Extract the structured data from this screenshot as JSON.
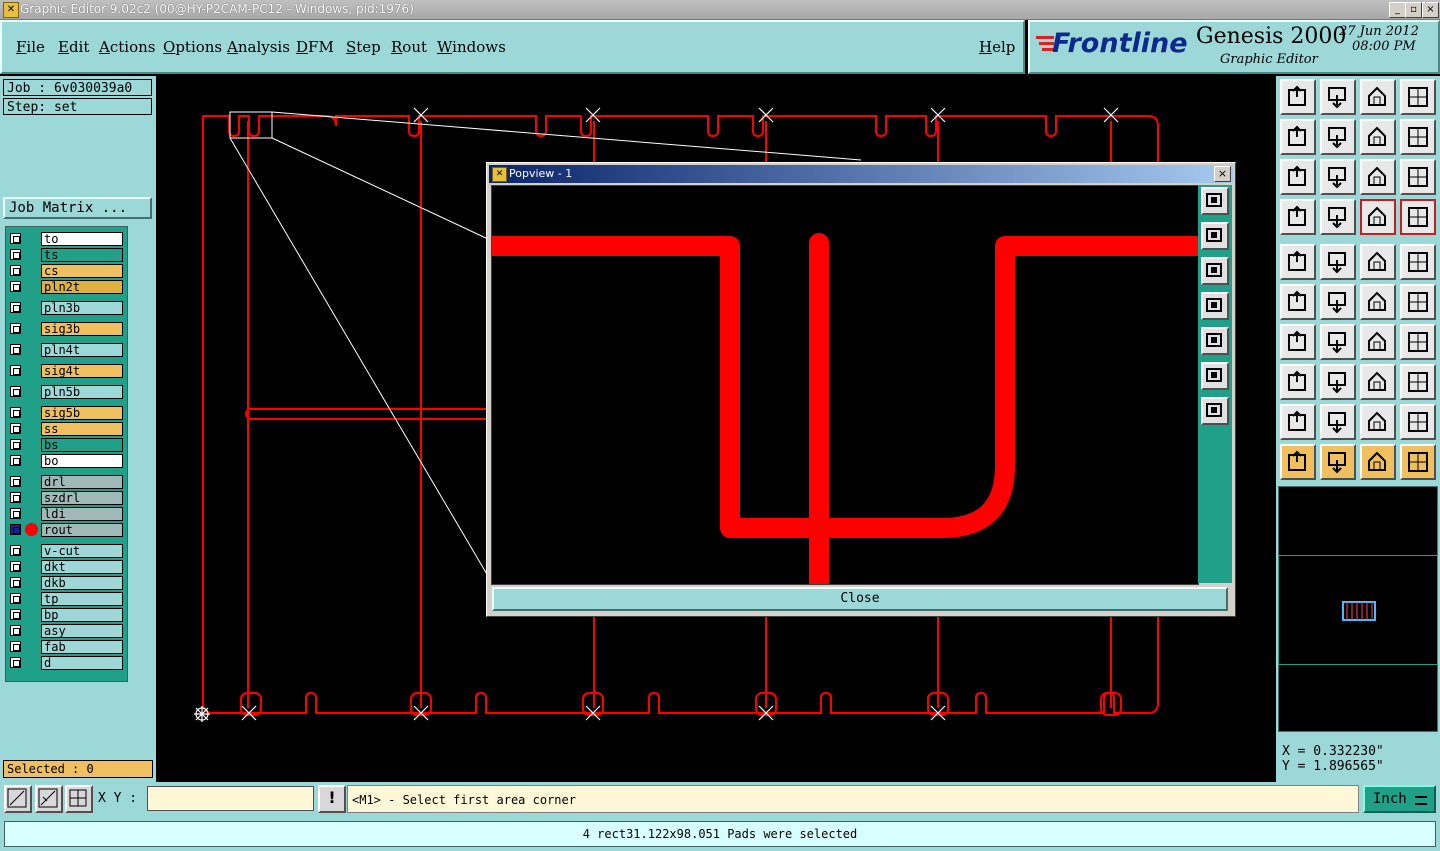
{
  "window": {
    "title": "Graphic Editor 9.02c2 (00@HY-P2CAM-PC12 - Windows, pid:1976)",
    "minimize": "_",
    "maximize": "▫",
    "close": "×"
  },
  "menubar": {
    "items": [
      "File",
      "Edit",
      "Actions",
      "Options",
      "Analysis",
      "DFM",
      "Step",
      "Rout",
      "Windows"
    ],
    "help": "Help"
  },
  "brand": {
    "logo": "Frontline",
    "product": "Genesis 2000",
    "subtitle": "Graphic Editor",
    "date": "27 Jun 2012",
    "time": "08:00 PM"
  },
  "job": {
    "job_label": "Job : 6v030039a0",
    "step_label": "Step: set",
    "matrix_button": "Job Matrix ..."
  },
  "layers": [
    {
      "name": "to",
      "color": "#ffffff"
    },
    {
      "name": "ts",
      "color": "#20a088"
    },
    {
      "name": "cs",
      "color": "#f0c060"
    },
    {
      "name": "pln2t",
      "color": "#e0b040"
    },
    {
      "name": "pln3b",
      "color": "#9cd8d8"
    },
    {
      "name": "sig3b",
      "color": "#f0c060"
    },
    {
      "name": "pln4t",
      "color": "#9cd8d8"
    },
    {
      "name": "sig4t",
      "color": "#f0c060"
    },
    {
      "name": "pln5b",
      "color": "#9cd8d8"
    },
    {
      "name": "sig5b",
      "color": "#f0c060"
    },
    {
      "name": "ss",
      "color": "#f0c060"
    },
    {
      "name": "bs",
      "color": "#20a088"
    },
    {
      "name": "bo",
      "color": "#ffffff"
    },
    {
      "name": "drl",
      "color": "#a0b8b8"
    },
    {
      "name": "szdrl",
      "color": "#a0b8b8"
    },
    {
      "name": "ldi",
      "color": "#a0b8b8"
    },
    {
      "name": "rout",
      "color": "#a0b8b8",
      "active": true
    },
    {
      "name": "v-cut",
      "color": "#9cd8d8"
    },
    {
      "name": "dkt",
      "color": "#9cd8d8"
    },
    {
      "name": "dkb",
      "color": "#9cd8d8"
    },
    {
      "name": "tp",
      "color": "#9cd8d8"
    },
    {
      "name": "bp",
      "color": "#9cd8d8"
    },
    {
      "name": "asy",
      "color": "#9cd8d8"
    },
    {
      "name": "fab",
      "color": "#9cd8d8"
    },
    {
      "name": "d",
      "color": "#9cd8d8"
    }
  ],
  "selected_label": "Selected : 0",
  "coords": {
    "x_label": "X = 0.332230\"",
    "y_label": "Y = 1.896565\""
  },
  "popview": {
    "title": "Popview - 1",
    "close_label": "Close"
  },
  "bottom": {
    "xy_label": "X Y :",
    "xy_value": "",
    "prompt": "<M1> - Select first area corner",
    "units": "Inch",
    "status": "4 rect31.122x98.051 Pads were selected"
  },
  "colors": {
    "rout": "#ff0000",
    "panel": "#9cd8d8",
    "accent": "#20a088"
  }
}
